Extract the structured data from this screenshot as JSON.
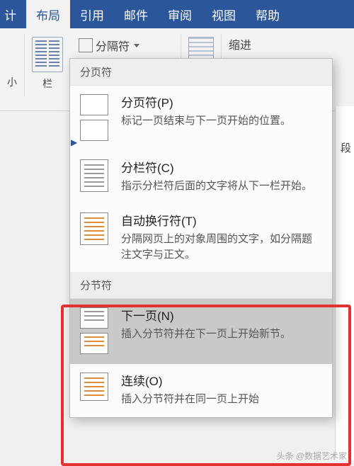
{
  "tabs": {
    "partial": "计",
    "layout": "布局",
    "references": "引用",
    "mailings": "邮件",
    "review": "审阅",
    "view": "视图",
    "help": "帮助"
  },
  "ribbon": {
    "size_small": "小",
    "columns_label": "栏",
    "breaks_label": "分隔符",
    "indent_label": "缩进",
    "paragraph_label": "段"
  },
  "dropdown": {
    "section_page_breaks": "分页符",
    "section_section_breaks": "分节符",
    "items": {
      "page": {
        "title": "分页符(P)",
        "desc": "标记一页结束与下一页开始的位置。"
      },
      "column": {
        "title": "分栏符(C)",
        "desc": "指示分栏符后面的文字将从下一栏开始。"
      },
      "textwrap": {
        "title": "自动换行符(T)",
        "desc": "分隔网页上的对象周围的文字，如分隔题注文字与正文。"
      },
      "nextpage": {
        "title": "下一页(N)",
        "desc": "插入分节符并在下一页上开始新节。"
      },
      "continuous": {
        "title": "连续(O)",
        "desc": "插入分节符并在同一页上开始"
      }
    }
  },
  "watermark": "头条 @数据艺术家"
}
